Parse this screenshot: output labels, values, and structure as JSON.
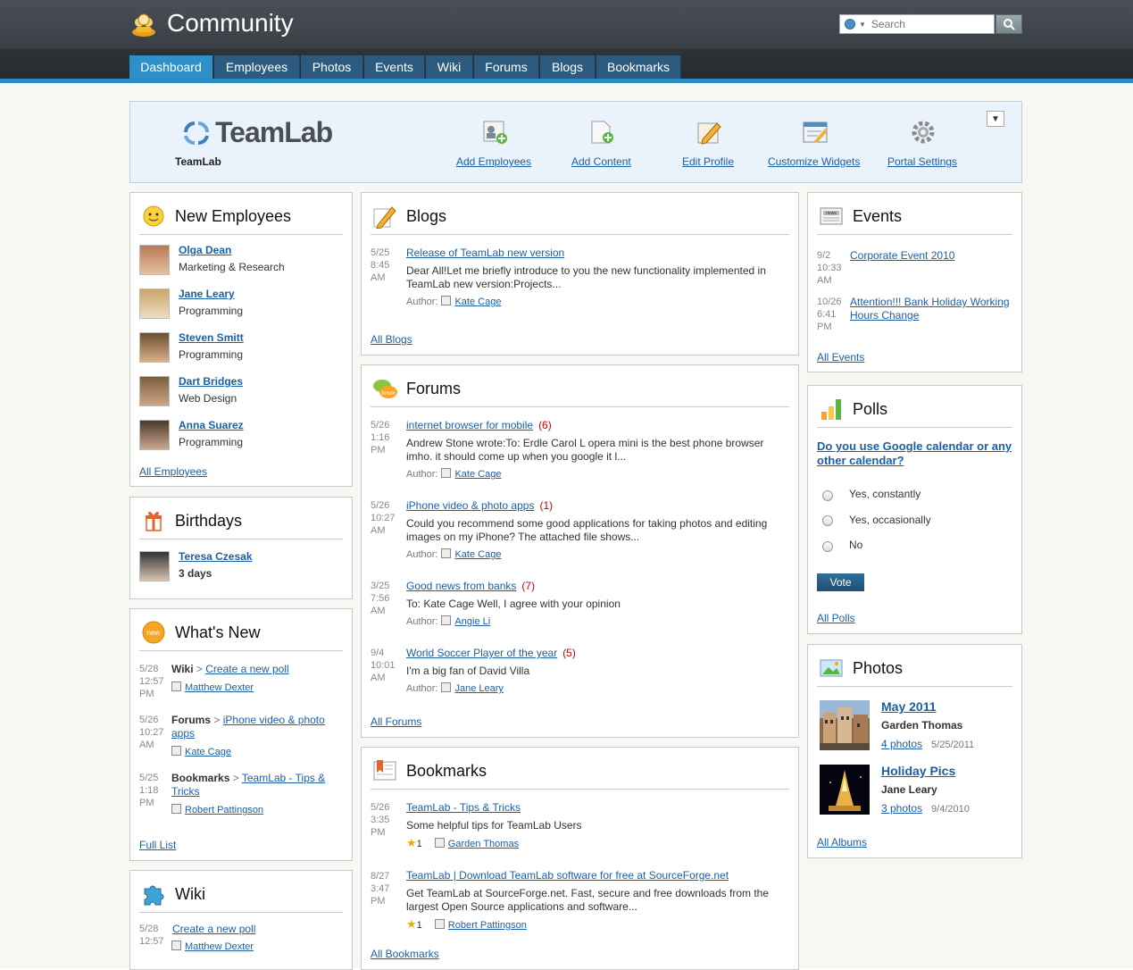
{
  "header": {
    "title": "Community",
    "search_placeholder": "Search"
  },
  "nav": {
    "tabs": [
      "Dashboard",
      "Employees",
      "Photos",
      "Events",
      "Wiki",
      "Forums",
      "Blogs",
      "Bookmarks"
    ]
  },
  "banner": {
    "logo_text": "TeamLab",
    "company": "TeamLab",
    "actions": [
      "Add Employees",
      "Add Content",
      "Edit Profile",
      "Customize Widgets",
      "Portal Settings"
    ]
  },
  "new_employees": {
    "title": "New Employees",
    "items": [
      {
        "name": "Olga Dean",
        "dept": "Marketing & Research"
      },
      {
        "name": "Jane Leary",
        "dept": "Programming"
      },
      {
        "name": "Steven Smitt",
        "dept": "Programming"
      },
      {
        "name": "Dart Bridges",
        "dept": "Web Design"
      },
      {
        "name": "Anna Suarez",
        "dept": "Programming"
      }
    ],
    "all": "All Employees"
  },
  "birthdays": {
    "title": "Birthdays",
    "name": "Teresa Czesak",
    "days": "3 days"
  },
  "whats_new": {
    "title": "What's New",
    "items": [
      {
        "d1": "5/28",
        "d2": "12:57",
        "d3": "PM",
        "module": "Wiki",
        "sep": ">",
        "link": "Create a new poll",
        "author": "Matthew Dexter"
      },
      {
        "d1": "5/26",
        "d2": "10:27",
        "d3": "AM",
        "module": "Forums",
        "sep": ">",
        "link": "iPhone video & photo apps",
        "author": "Kate Cage"
      },
      {
        "d1": "5/25",
        "d2": "1:18",
        "d3": "PM",
        "module": "Bookmarks",
        "sep": ">",
        "link": "TeamLab - Tips & Tricks",
        "author": "Robert Pattingson"
      }
    ],
    "all": "Full List"
  },
  "wiki": {
    "title": "Wiki",
    "d1": "5/28",
    "d2": "12:57",
    "link": "Create a new poll",
    "author": "Matthew Dexter"
  },
  "blogs": {
    "title": "Blogs",
    "d1": "5/25",
    "d2": "8:45",
    "d3": "AM",
    "link": "Release of TeamLab new version",
    "text": "Dear All!Let me briefly introduce to you the new functionality implemented in TeamLab new version:Projects...",
    "author_label": "Author:",
    "author": "Kate Cage",
    "all": "All Blogs"
  },
  "forums": {
    "title": "Forums",
    "items": [
      {
        "d1": "5/26",
        "d2": "1:16",
        "d3": "PM",
        "link": "internet browser for mobile",
        "count": "(6)",
        "text": "Andrew Stone wrote:To: Erdle Carol L opera mini is the best phone browser imho. it should come up when you google it l...",
        "author": "Kate Cage"
      },
      {
        "d1": "5/26",
        "d2": "10:27",
        "d3": "AM",
        "link": "iPhone video & photo apps",
        "count": "(1)",
        "text": "Could you recommend some good applications for taking photos and editing images on my iPhone? The attached file shows...",
        "author": "Kate Cage"
      },
      {
        "d1": "3/25",
        "d2": "7:56",
        "d3": "AM",
        "link": "Good news from banks",
        "count": "(7)",
        "text": "To: Kate Cage Well, I agree with your opinion",
        "author": "Angie Li"
      },
      {
        "d1": "9/4",
        "d2": "10:01",
        "d3": "AM",
        "link": "World Soccer Player of the year",
        "count": "(5)",
        "text": "I'm a big fan of David Villa",
        "author": "Jane Leary"
      }
    ],
    "author_label": "Author:",
    "all": "All Forums"
  },
  "bookmarks": {
    "title": "Bookmarks",
    "items": [
      {
        "d1": "5/26",
        "d2": "3:35",
        "d3": "PM",
        "link": "TeamLab - Tips & Tricks",
        "text": "Some helpful tips for TeamLab Users",
        "stars": "1",
        "author": "Garden Thomas"
      },
      {
        "d1": "8/27",
        "d2": "3:47",
        "d3": "PM",
        "link": "TeamLab | Download TeamLab software for free at SourceForge.net",
        "text": "Get TeamLab at SourceForge.net. Fast, secure and free downloads from the largest Open Source applications and software...",
        "stars": "1",
        "author": "Robert Pattingson"
      }
    ],
    "all": "All Bookmarks"
  },
  "events": {
    "title": "Events",
    "items": [
      {
        "d1": "9/2",
        "d2": "10:33",
        "d3": "AM",
        "link": "Corporate Event 2010"
      },
      {
        "d1": "10/26",
        "d2": "6:41",
        "d3": "PM",
        "link": "Attention!!! Bank Holiday Working Hours Change"
      }
    ],
    "all": "All Events"
  },
  "polls": {
    "title": "Polls",
    "question": "Do you use Google calendar or any other calendar?",
    "options": [
      "Yes, constantly",
      "Yes, occasionally",
      "No"
    ],
    "vote": "Vote",
    "all": "All Polls"
  },
  "photos": {
    "title": "Photos",
    "albums": [
      {
        "name": "May 2011",
        "owner": "Garden Thomas",
        "count": "4 photos",
        "date": "5/25/2011"
      },
      {
        "name": "Holiday Pics",
        "owner": "Jane Leary",
        "count": "3 photos",
        "date": "9/4/2010"
      }
    ],
    "all": "All Albums"
  }
}
